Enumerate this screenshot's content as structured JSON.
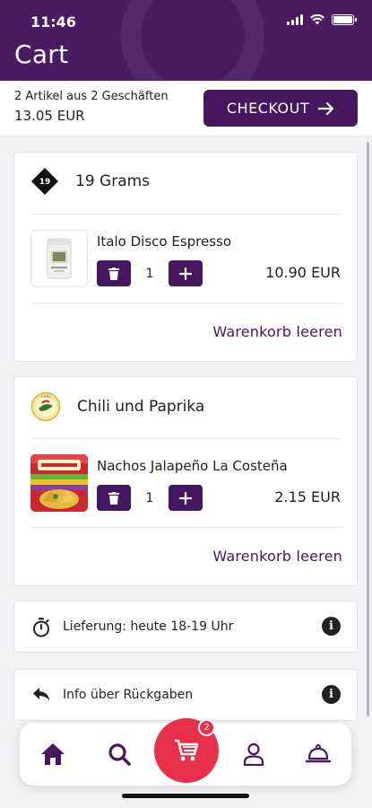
{
  "status_bar": {
    "time": "11:46"
  },
  "header": {
    "title": "Cart"
  },
  "summary": {
    "line1": "2 Artikel aus 2 Geschäften",
    "total": "13.05 EUR",
    "checkout_label": "CHECKOUT"
  },
  "shops": [
    {
      "name": "19 Grams",
      "product": {
        "name": "Italo Disco Espresso",
        "qty": "1",
        "price": "10.90 EUR"
      },
      "clear_label": "Warenkorb leeren"
    },
    {
      "name": "Chili und Paprika",
      "product": {
        "name": "Nachos Jalapeño La Costeña",
        "qty": "1",
        "price": "2.15 EUR"
      },
      "clear_label": "Warenkorb leeren"
    }
  ],
  "info": {
    "delivery_label": "Lieferung: heute 18-19 Uhr",
    "returns_label": "Info über Rückgaben"
  },
  "nav": {
    "cart_badge": "2"
  },
  "colors": {
    "brand": "#46175f",
    "accent": "#e8304a"
  }
}
